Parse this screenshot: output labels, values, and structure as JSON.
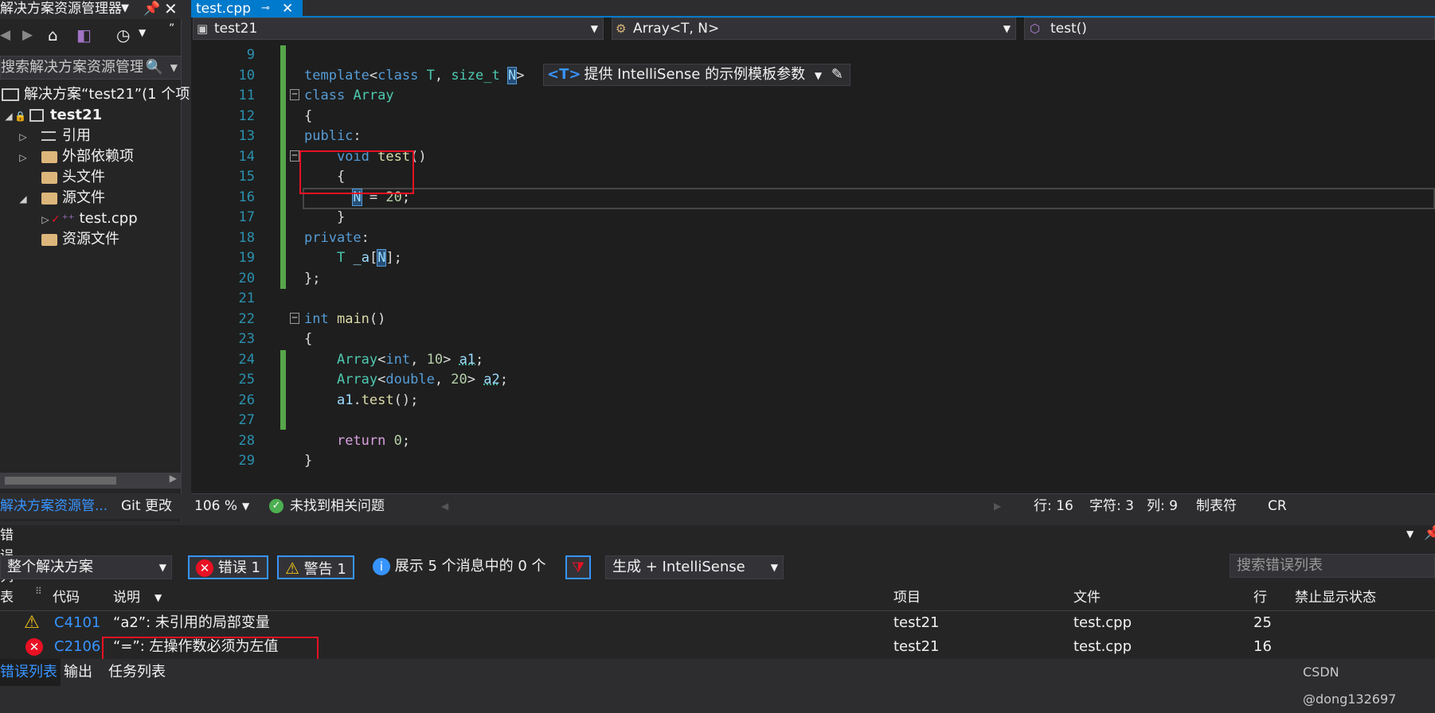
{
  "solution_explorer": {
    "title": "解决方案资源管理器",
    "search_placeholder": "搜索解决方案资源管理器",
    "tree": {
      "solution": "解决方案“test21”(1 个项",
      "project": "test21",
      "references": "引用",
      "external_deps": "外部依赖项",
      "headers": "头文件",
      "sources": "源文件",
      "file": "test.cpp",
      "resources": "资源文件"
    },
    "bottom_tabs": [
      "解决方案资源管...",
      "Git 更改"
    ]
  },
  "editor": {
    "tab_label": "test.cpp",
    "nav": {
      "project": "test21",
      "scope": "Array<T, N>",
      "member": "test()"
    },
    "intellisense_hint": {
      "tag": "<T>",
      "text": "提供 IntelliSense 的示例模板参数"
    },
    "line_numbers": [
      "9",
      "10",
      "11",
      "12",
      "13",
      "14",
      "15",
      "16",
      "17",
      "18",
      "19",
      "20",
      "21",
      "22",
      "23",
      "24",
      "25",
      "26",
      "27",
      "28",
      "29"
    ],
    "status": {
      "zoom": "106 %",
      "issues": "未找到相关问题",
      "row": "行: 16",
      "char": "字符: 3",
      "col": "列: 9",
      "tab": "制表符",
      "enc": "CR"
    }
  },
  "error_list": {
    "title": "错误列表",
    "scope": "整个解决方案",
    "errors_btn": "错误 1",
    "warnings_btn": "警告 1",
    "messages_btn": "展示 5 个消息中的 0 个",
    "build_filter": "生成 + IntelliSense",
    "search_placeholder": "搜索错误列表",
    "columns": {
      "code": "代码",
      "desc": "说明",
      "project": "项目",
      "file": "文件",
      "line": "行",
      "suppress": "禁止显示状态"
    },
    "rows": [
      {
        "code": "C4101",
        "desc": "“a2”: 未引用的局部变量",
        "project": "test21",
        "file": "test.cpp",
        "line": "25"
      },
      {
        "code": "C2106",
        "desc": "“=”: 左操作数必须为左值",
        "project": "test21",
        "file": "test.cpp",
        "line": "16"
      }
    ],
    "bottom_tabs": [
      "错误列表",
      "输出",
      "任务列表"
    ]
  },
  "watermark": "CSDN @dong132697",
  "colors": {
    "accent": "#007acc",
    "error": "#e81123",
    "warning": "#f5c518",
    "link": "#3794ff"
  }
}
